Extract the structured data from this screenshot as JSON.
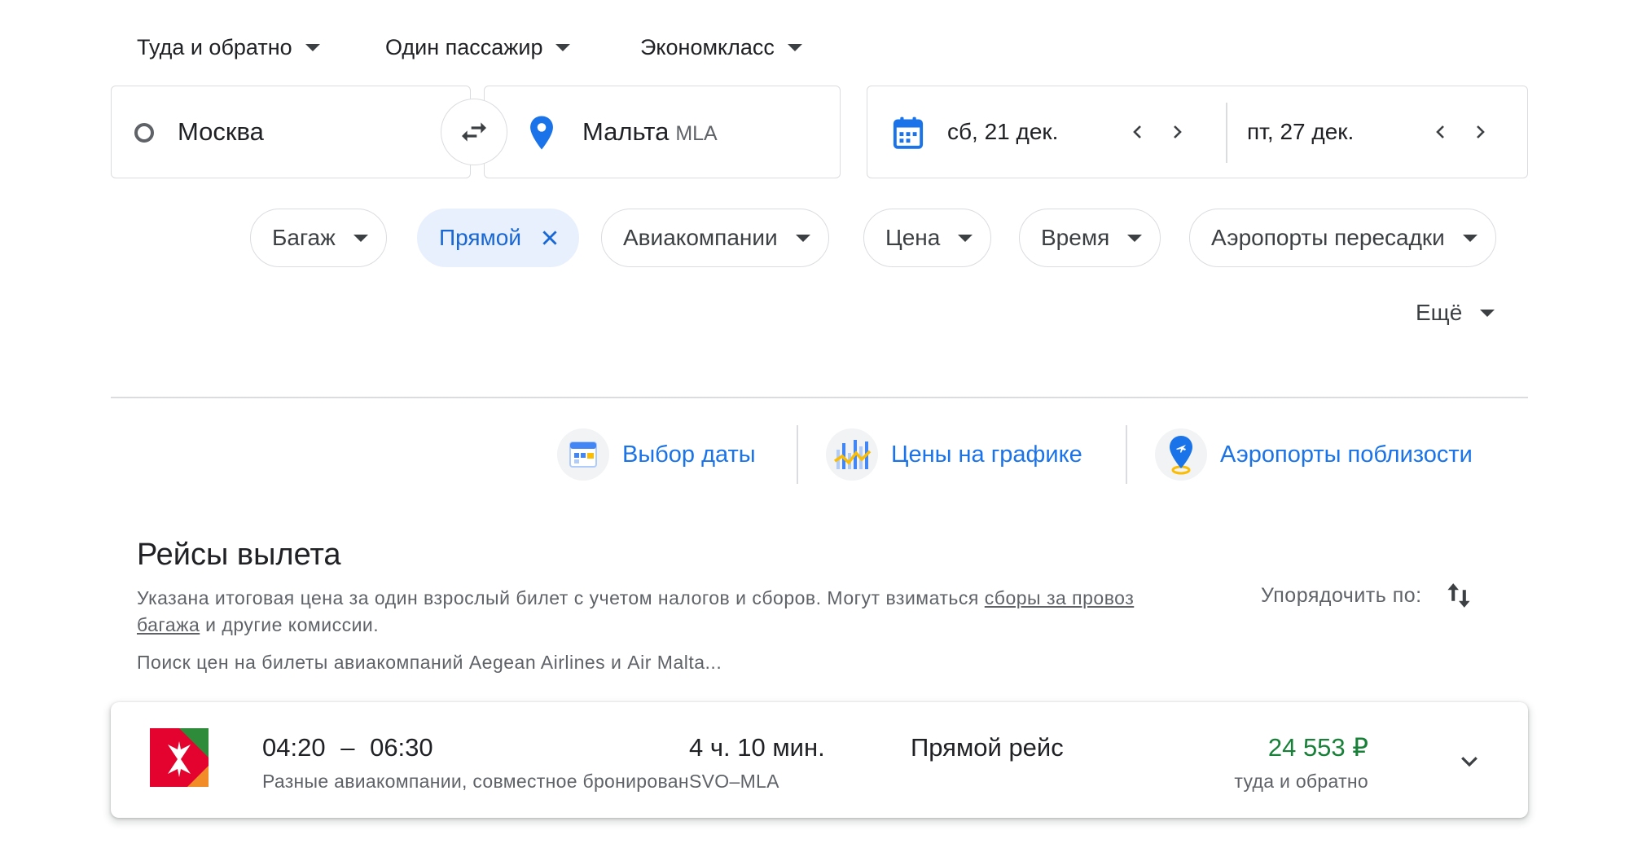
{
  "trip_options": {
    "trip_type": "Туда и обратно",
    "passengers": "Один пассажир",
    "cabin_class": "Экономкласс"
  },
  "search": {
    "origin": "Москва",
    "destination": "Мальта",
    "destination_code": "MLA",
    "depart_date": "сб, 21 дек.",
    "return_date": "пт, 27 дек."
  },
  "filters": {
    "baggage": "Багаж",
    "direct": "Прямой",
    "airlines": "Авиакомпании",
    "price": "Цена",
    "time": "Время",
    "connecting_airports": "Аэропорты пересадки",
    "more": "Ещё"
  },
  "tools": {
    "date_grid": "Выбор даты",
    "price_graph": "Цены на графике",
    "nearby_airports": "Аэропорты поблизости"
  },
  "results": {
    "title": "Рейсы вылета",
    "note_before_link": "Указана итоговая цена за один взрослый билет с учетом налогов и сборов. Могут взиматься ",
    "note_link": "сборы за провоз багажа",
    "note_after_link": " и другие комиссии.",
    "searching": "Поиск цен на билеты авиакомпаний Aegean Airlines и Air Malta...",
    "sort_label": "Упорядочить по:",
    "flights": [
      {
        "depart_time": "04:20",
        "separator": "–",
        "arrive_time": "06:30",
        "airline": "Разные авиакомпании, совместное бронирование",
        "duration": "4 ч. 10 мин.",
        "route": "SVO–MLA",
        "stops": "Прямой рейс",
        "price": "24 553 ₽",
        "price_note": "туда и обратно"
      }
    ]
  },
  "colors": {
    "accent_blue": "#1a73e8",
    "chip_active_bg": "#e8f0fe",
    "price_green": "#188038",
    "logo_red": "#e4032e",
    "logo_orange": "#f28c28"
  }
}
